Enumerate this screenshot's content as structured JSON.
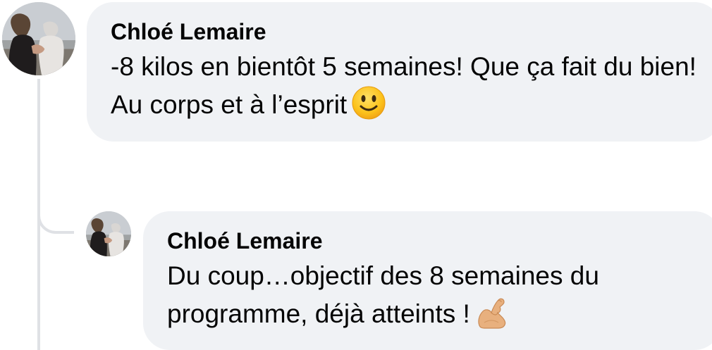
{
  "comments": [
    {
      "author": "Chloé Lemaire",
      "text": "-8 kilos en bientôt 5 semaines! Que ça fait du bien! Au corps et à l’esprit",
      "emoji": "slightly-smiling-face-icon"
    }
  ],
  "replies": [
    {
      "author": "Chloé Lemaire",
      "text": "Du coup…objectif des 8 semaines du programme, déjà atteints !",
      "emoji": "flexed-biceps-icon"
    }
  ],
  "colors": {
    "bubble_background": "#f0f2f5",
    "thread_line": "#dfe1e5",
    "text": "#050505"
  }
}
